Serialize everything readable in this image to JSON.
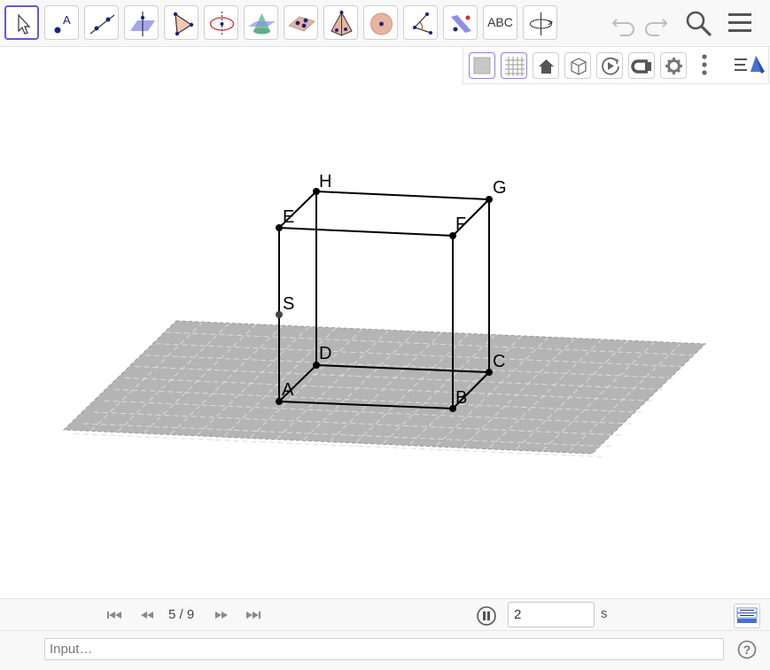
{
  "toolbar": {
    "tools": [
      {
        "name": "move-tool",
        "icon": "arrow-cursor-icon",
        "active": true
      },
      {
        "name": "point-tool",
        "icon": "point-icon"
      },
      {
        "name": "line-tool",
        "icon": "line-icon"
      },
      {
        "name": "perpendicular-line-tool",
        "icon": "perpendicular-line-icon"
      },
      {
        "name": "polygon-tool",
        "icon": "triangle-icon"
      },
      {
        "name": "circle-axis-tool",
        "icon": "circle-axis-icon"
      },
      {
        "name": "intersect-surfaces-tool",
        "icon": "cone-intersect-icon"
      },
      {
        "name": "plane-tool",
        "icon": "plane-points-icon"
      },
      {
        "name": "pyramid-tool",
        "icon": "pyramid-icon"
      },
      {
        "name": "sphere-tool",
        "icon": "sphere-icon"
      },
      {
        "name": "angle-tool",
        "icon": "angle-icon"
      },
      {
        "name": "reflect-tool",
        "icon": "reflect-plane-icon"
      },
      {
        "name": "text-tool",
        "icon": "text-icon",
        "label": "ABC"
      },
      {
        "name": "rotate-view-tool",
        "icon": "rotate-view-icon"
      }
    ],
    "right": [
      "undo-icon",
      "redo-icon",
      "search-icon",
      "menu-icon"
    ]
  },
  "style_bar": {
    "buttons": [
      "show-plane-icon",
      "grid-icon",
      "home-icon",
      "cube-view-icon",
      "rotate-animation-icon",
      "stereo-glasses-icon",
      "gear-icon",
      "more-vertical-icon",
      "view-toggle-icon"
    ]
  },
  "scene": {
    "points": {
      "A": "A",
      "B": "B",
      "C": "C",
      "D": "D",
      "E": "E",
      "F": "F",
      "G": "G",
      "H": "H",
      "S": "S"
    },
    "plane_color": "#b4b4b4"
  },
  "animation": {
    "slide": "5 / 9",
    "speed": "2",
    "unit": "s"
  },
  "input_bar": {
    "placeholder": "Input…"
  },
  "colors": {
    "accent": "#6557d2",
    "tool_blue": "#1a237e",
    "plane_fill": "#b4b4b4"
  }
}
